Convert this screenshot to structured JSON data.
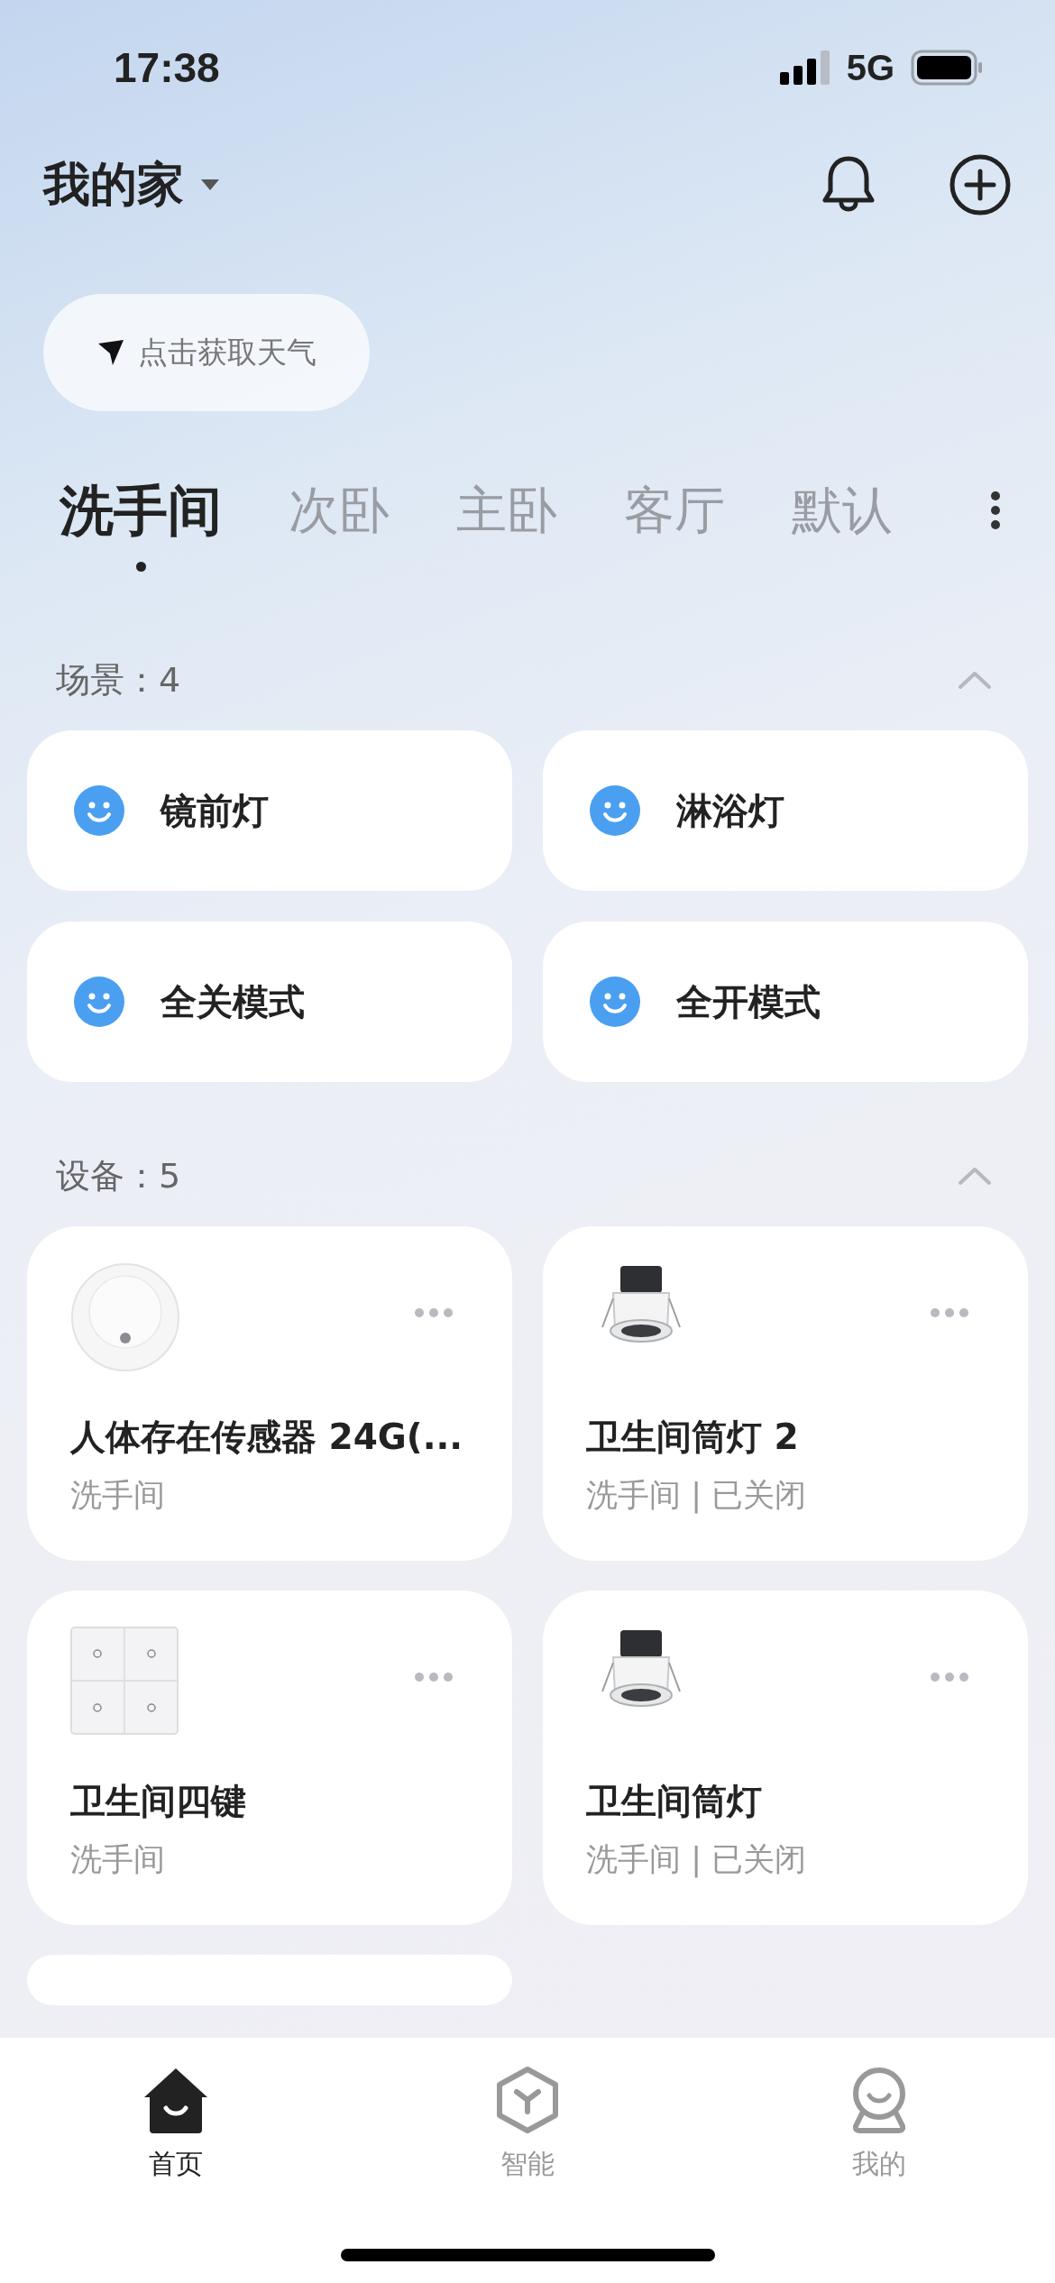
{
  "status_bar": {
    "time": "17:38",
    "network": "5G"
  },
  "header": {
    "home_name": "我的家"
  },
  "weather": {
    "label": "点击获取天气"
  },
  "room_tabs": [
    {
      "label": "洗手间",
      "selected": true
    },
    {
      "label": "次卧",
      "selected": false
    },
    {
      "label": "主卧",
      "selected": false
    },
    {
      "label": "客厅",
      "selected": false
    },
    {
      "label": "默认",
      "selected": false
    }
  ],
  "scenes": {
    "title": "场景：4",
    "items": [
      {
        "name": "镜前灯"
      },
      {
        "name": "淋浴灯"
      },
      {
        "name": "全关模式"
      },
      {
        "name": "全开模式"
      }
    ]
  },
  "devices": {
    "title": "设备：5",
    "items": [
      {
        "kind": "sensor",
        "name": "人体存在传感器 24G(...",
        "subtitle": "洗手间"
      },
      {
        "kind": "downlight",
        "name": "卫生间筒灯 2",
        "subtitle": "洗手间 | 已关闭"
      },
      {
        "kind": "switch",
        "name": "卫生间四键",
        "subtitle": "洗手间"
      },
      {
        "kind": "downlight",
        "name": "卫生间筒灯",
        "subtitle": "洗手间 | 已关闭"
      }
    ]
  },
  "bottom_nav": [
    {
      "kind": "home",
      "label": "首页",
      "selected": true
    },
    {
      "kind": "smart",
      "label": "智能",
      "selected": false
    },
    {
      "kind": "profile",
      "label": "我的",
      "selected": false
    }
  ]
}
